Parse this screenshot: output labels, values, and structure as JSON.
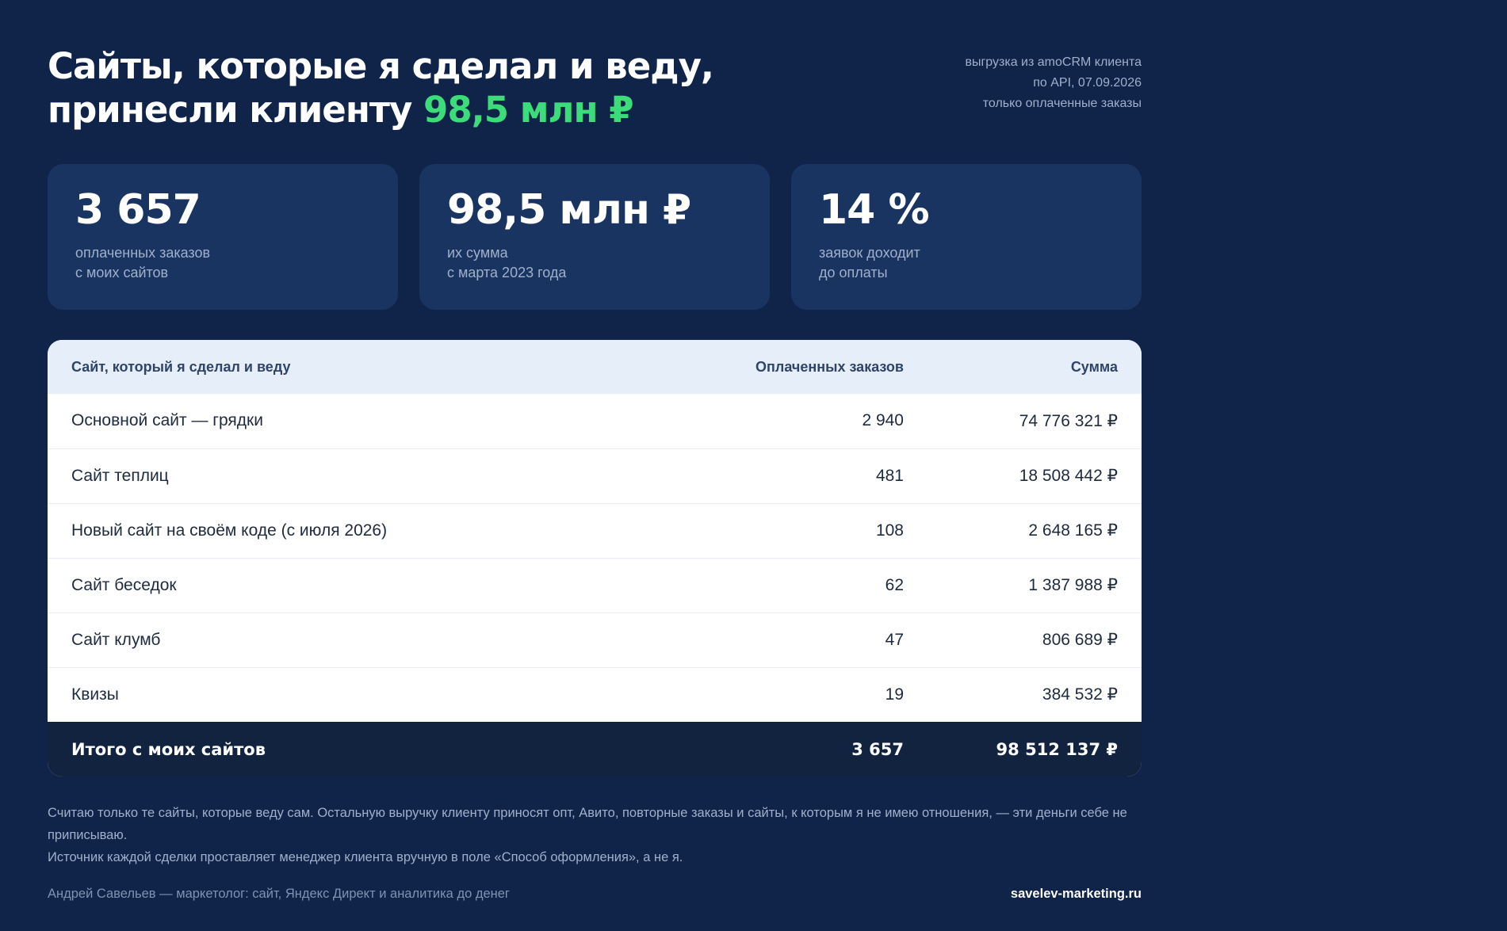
{
  "header": {
    "title_line1": "Сайты, которые я сделал и веду,",
    "title_line2_prefix": "принесли клиенту ",
    "title_accent": "98,5 млн ₽",
    "meta": [
      "выгрузка из amoCRM клиента",
      "по API, 07.09.2026",
      "только оплаченные заказы"
    ]
  },
  "stats": [
    {
      "value": "3 657",
      "label_line1": "оплаченных заказов",
      "label_line2": "с моих сайтов"
    },
    {
      "value": "98,5 млн ₽",
      "label_line1": "их сумма",
      "label_line2": "с марта 2023 года"
    },
    {
      "value": "14 %",
      "label_line1": "заявок доходит",
      "label_line2": "до оплаты"
    }
  ],
  "table": {
    "headers": [
      "Сайт, который я сделал и веду",
      "Оплаченных заказов",
      "Сумма"
    ],
    "rows": [
      {
        "site": "Основной сайт — грядки",
        "orders": "2 940",
        "sum": "74 776 321 ₽"
      },
      {
        "site": "Сайт теплиц",
        "orders": "481",
        "sum": "18 508 442 ₽"
      },
      {
        "site": "Новый сайт на своём коде (с июля 2026)",
        "orders": "108",
        "sum": "2 648 165 ₽"
      },
      {
        "site": "Сайт беседок",
        "orders": "62",
        "sum": "1 387 988 ₽"
      },
      {
        "site": "Сайт клумб",
        "orders": "47",
        "sum": "806 689 ₽"
      },
      {
        "site": "Квизы",
        "orders": "19",
        "sum": "384 532 ₽"
      }
    ],
    "total": {
      "label": "Итого с моих сайтов",
      "orders": "3 657",
      "sum": "98 512 137 ₽"
    }
  },
  "notes": [
    "Считаю только те сайты, которые веду сам. Остальную выручку клиенту приносят опт, Авито, повторные заказы и сайты, к которым я не имею отношения, — эти деньги себе не приписываю.",
    "Источник каждой сделки проставляет менеджер клиента вручную в поле «Способ оформления», а не я."
  ],
  "footer": {
    "author": "Андрей Савельев — маркетолог: сайт, Яндекс Директ и аналитика до денег",
    "site": "savelev-marketing.ru"
  },
  "colors": {
    "background": "#10244a",
    "card": "#1a3462",
    "accent": "#3ddc7a",
    "table_header": "#e6eef9",
    "table_footer": "#122340"
  }
}
